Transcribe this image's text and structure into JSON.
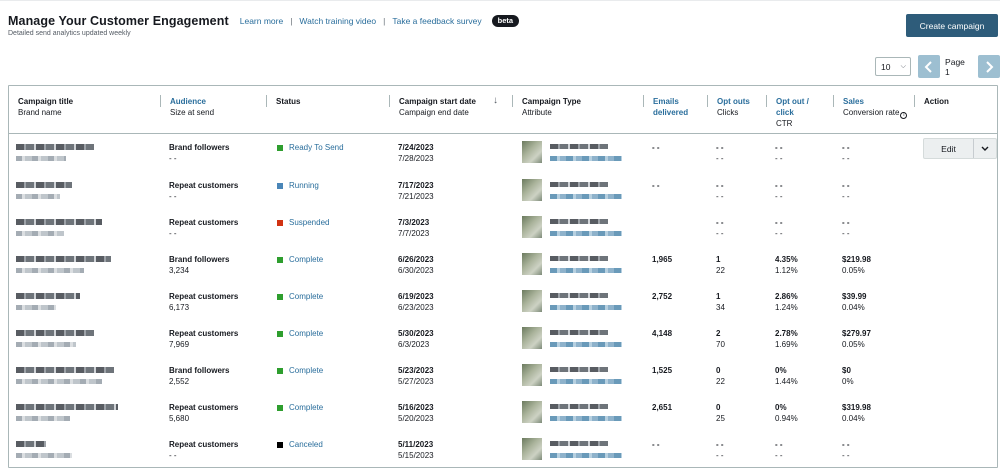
{
  "header": {
    "title": "Manage Your Customer Engagement",
    "subtitle": "Detailed send analytics updated weekly",
    "links": [
      "Learn more",
      "Watch training video",
      "Take a feedback survey"
    ],
    "separator": "|",
    "badge": "beta",
    "create_label": "Create campaign"
  },
  "pager": {
    "page_size": "10",
    "page_label": "Page 1"
  },
  "columns": {
    "title": {
      "l1": "Campaign title",
      "l2": "Brand name"
    },
    "audience": {
      "l1": "Audience",
      "l2": "Size at send"
    },
    "status": {
      "l1": "Status"
    },
    "dates": {
      "l1": "Campaign start date",
      "l2": "Campaign end date"
    },
    "type": {
      "l1": "Campaign Type",
      "l2": "Attribute"
    },
    "emails": {
      "l1": "Emails",
      "l2": "delivered"
    },
    "optouts": {
      "l1": "Opt outs",
      "l2": "Clicks"
    },
    "optout_click": {
      "l1": "Opt out /",
      "l2": "click",
      "l3": "CTR"
    },
    "sales": {
      "l1": "Sales",
      "l2": "Conversion rate"
    },
    "action": {
      "l1": "Action"
    }
  },
  "colors": {
    "ready": "#2e9e2e",
    "running": "#4a86b8",
    "suspended": "#d13212",
    "complete": "#2e9e2e",
    "canceled": "#000000"
  },
  "action": {
    "edit_label": "Edit"
  },
  "rows": [
    {
      "audience": "Brand followers",
      "size": "- -",
      "status": "Ready To Send",
      "status_color": "#2e9e2e",
      "start": "7/24/2023",
      "end": "7/28/2023",
      "emails": "- -",
      "optouts": "- -",
      "clicks": "- -",
      "optout_click": "- -",
      "ctr": "- -",
      "sales": "- -",
      "conv": "- -"
    },
    {
      "audience": "Repeat customers",
      "size": "- -",
      "status": "Running",
      "status_color": "#4a86b8",
      "start": "7/17/2023",
      "end": "7/21/2023",
      "emails": "- -",
      "optouts": "- -",
      "clicks": "- -",
      "optout_click": "- -",
      "ctr": "- -",
      "sales": "- -",
      "conv": "- -"
    },
    {
      "audience": "Repeat customers",
      "size": "- -",
      "status": "Suspended",
      "status_color": "#d13212",
      "start": "7/3/2023",
      "end": "7/7/2023",
      "emails": "",
      "optouts": "- -",
      "clicks": "- -",
      "optout_click": "- -",
      "ctr": "- -",
      "sales": "- -",
      "conv": "- -"
    },
    {
      "audience": "Brand followers",
      "size": "3,234",
      "status": "Complete",
      "status_color": "#2e9e2e",
      "start": "6/26/2023",
      "end": "6/30/2023",
      "emails": "1,965",
      "optouts": "1",
      "clicks": "22",
      "optout_click": "4.35%",
      "ctr": "1.12%",
      "sales": "$219.98",
      "conv": "0.05%"
    },
    {
      "audience": "Repeat customers",
      "size": "6,173",
      "status": "Complete",
      "status_color": "#2e9e2e",
      "start": "6/19/2023",
      "end": "6/23/2023",
      "emails": "2,752",
      "optouts": "1",
      "clicks": "34",
      "optout_click": "2.86%",
      "ctr": "1.24%",
      "sales": "$39.99",
      "conv": "0.04%"
    },
    {
      "audience": "Repeat customers",
      "size": "7,969",
      "status": "Complete",
      "status_color": "#2e9e2e",
      "start": "5/30/2023",
      "end": "6/3/2023",
      "emails": "4,148",
      "optouts": "2",
      "clicks": "70",
      "optout_click": "2.78%",
      "ctr": "1.69%",
      "sales": "$279.97",
      "conv": "0.05%"
    },
    {
      "audience": "Brand followers",
      "size": "2,552",
      "status": "Complete",
      "status_color": "#2e9e2e",
      "start": "5/23/2023",
      "end": "5/27/2023",
      "emails": "1,525",
      "optouts": "0",
      "clicks": "22",
      "optout_click": "0%",
      "ctr": "1.44%",
      "sales": "$0",
      "conv": "0%"
    },
    {
      "audience": "Repeat customers",
      "size": "5,680",
      "status": "Complete",
      "status_color": "#2e9e2e",
      "start": "5/16/2023",
      "end": "5/20/2023",
      "emails": "2,651",
      "optouts": "0",
      "clicks": "25",
      "optout_click": "0%",
      "ctr": "0.94%",
      "sales": "$319.98",
      "conv": "0.04%"
    },
    {
      "audience": "Repeat customers",
      "size": "- -",
      "status": "Canceled",
      "status_color": "#000000",
      "start": "5/11/2023",
      "end": "5/15/2023",
      "emails": "- -",
      "optouts": "- -",
      "clicks": "- -",
      "optout_click": "- -",
      "ctr": "- -",
      "sales": "- -",
      "conv": "- -"
    }
  ]
}
